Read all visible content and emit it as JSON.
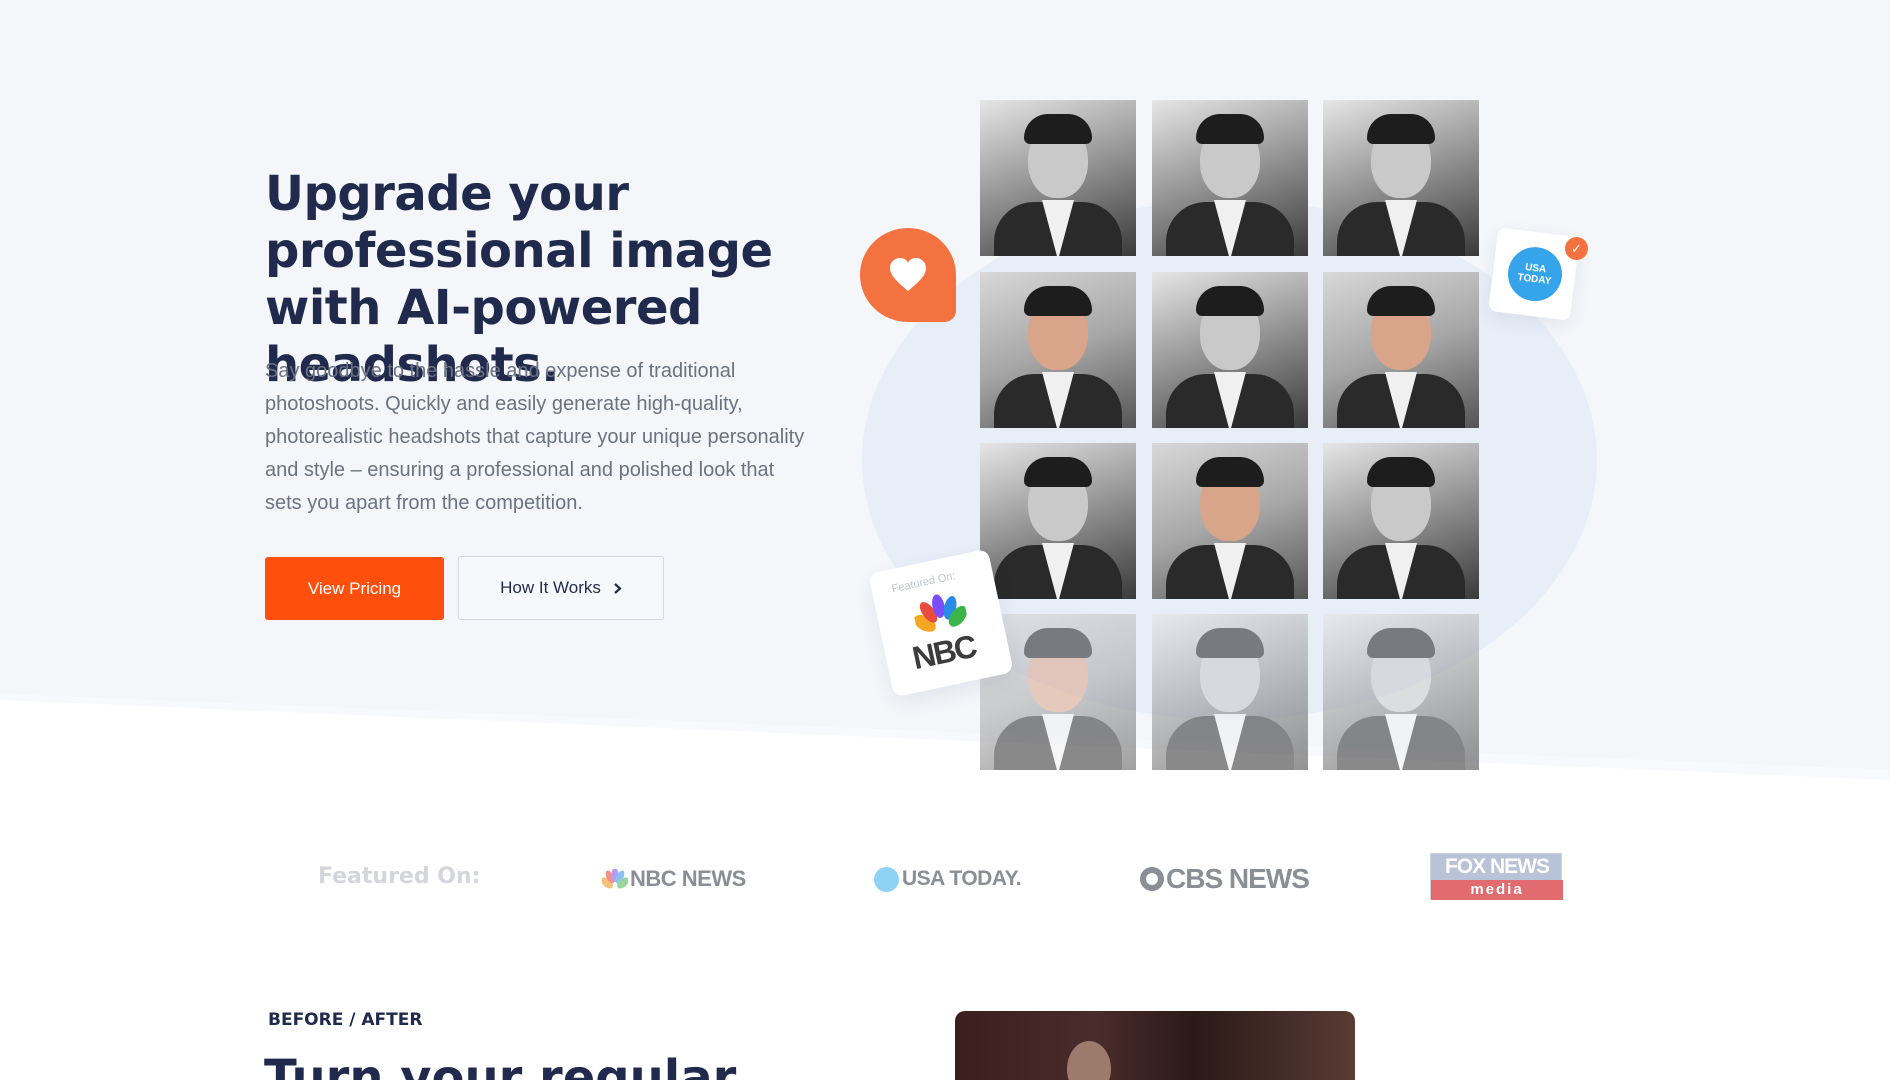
{
  "hero": {
    "headline": "Upgrade your professional image with AI-powered headshots.",
    "subtext": "Say goodbye to the hassle and expense of traditional photoshoots. Quickly and easily generate high-quality, photorealistic headshots that capture your unique personality and style – ensuring a professional and polished look that sets you apart from the competition.",
    "primary_button": "View Pricing",
    "secondary_button": "How It Works"
  },
  "collage": {
    "usa_badge": "USA TODAY",
    "nbc_card_caption": "Featured On:",
    "nbc_card_logo": "NBC"
  },
  "featured": {
    "label": "Featured On:",
    "logos": {
      "nbc": "NBC NEWS",
      "usa": "USA TODAY.",
      "cbs": "CBS NEWS",
      "fox_top": "FOX NEWS",
      "fox_bottom": "media"
    }
  },
  "before_after": {
    "label": "BEFORE / AFTER",
    "title": "Turn your regular"
  },
  "colors": {
    "accent": "#ff4f0c",
    "heading": "#1f2a4d",
    "body_text": "#6b7280",
    "hero_background": "#f4f6fa"
  }
}
